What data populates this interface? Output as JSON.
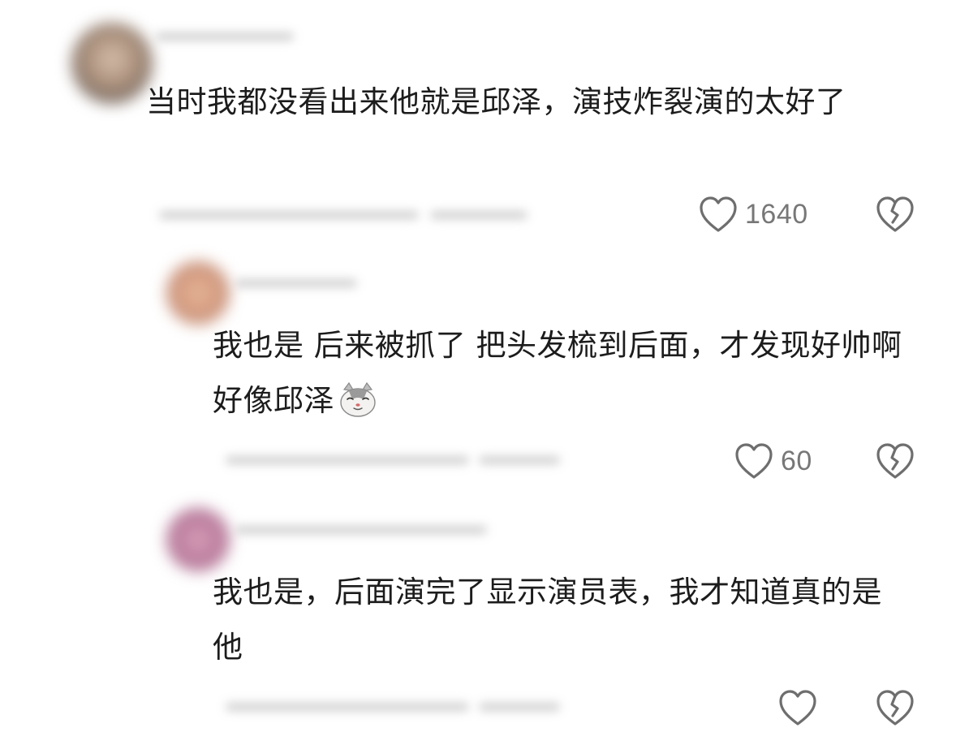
{
  "comments": [
    {
      "text": "当时我都没看出来他就是邱泽，演技炸裂演的太好了",
      "likes": "1640"
    },
    {
      "text": "我也是 后来被抓了 把头发梳到后面，才发现好帅啊 好像邱泽",
      "emoji": "cat-emoji",
      "likes": "60"
    },
    {
      "text": "我也是，后面演完了显示演员表，我才知道真的是他",
      "likes": ""
    }
  ],
  "icons": {
    "like": "heart-outline-icon",
    "dislike": "broken-heart-icon"
  },
  "colors": {
    "text": "#1c1c1c",
    "meta": "#777777",
    "icon": "#6e6e6e",
    "background": "#ffffff"
  }
}
